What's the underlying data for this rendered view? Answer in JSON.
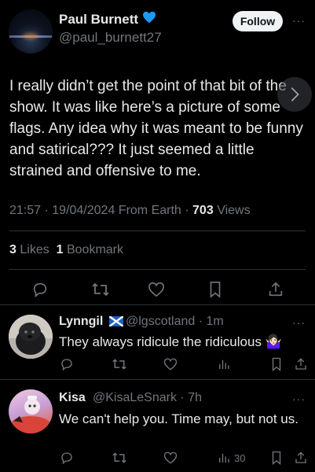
{
  "tweet": {
    "display_name": "Paul Burnett",
    "name_emoji": "💙",
    "handle": "@paul_burnett27",
    "follow_label": "Follow",
    "more_label": "···",
    "text": "I really didn’t get the point of that bit of the show. It was like here’s a picture of some flags. Any idea why it was meant to be funny and satirical??? It just seemed a little strained and offensive to me.",
    "time": "21:57",
    "date": "19/04/2024",
    "source": "From Earth",
    "views_count": "703",
    "views_label": "Views",
    "likes_count": "3",
    "likes_label": "Likes",
    "bookmarks_count": "1",
    "bookmarks_label": "Bookmark"
  },
  "replies": [
    {
      "display_name": "Lynngil",
      "flag": "🏴󠁧󠁢󠁳󠁣󠁴󠁿",
      "handle": "@lgscotland",
      "age": "· 1m",
      "text": "They always ridicule the ridiculous 🤷🏻‍♀️",
      "views": ""
    },
    {
      "display_name": "Kisa",
      "handle": "@KisaLeSnark",
      "age": "· 7h",
      "text": "We can't help you. Time may, but not us.",
      "views": "30"
    }
  ],
  "icons": {
    "reply": "reply-icon",
    "retweet": "retweet-icon",
    "like": "heart-icon",
    "bookmark": "bookmark-icon",
    "share": "share-icon",
    "views": "views-icon"
  },
  "colors": {
    "background": "#000000",
    "text": "#e7e9ea",
    "secondary": "#71767b",
    "divider": "#2f3336",
    "verified_heart": "#1d9bf0"
  }
}
